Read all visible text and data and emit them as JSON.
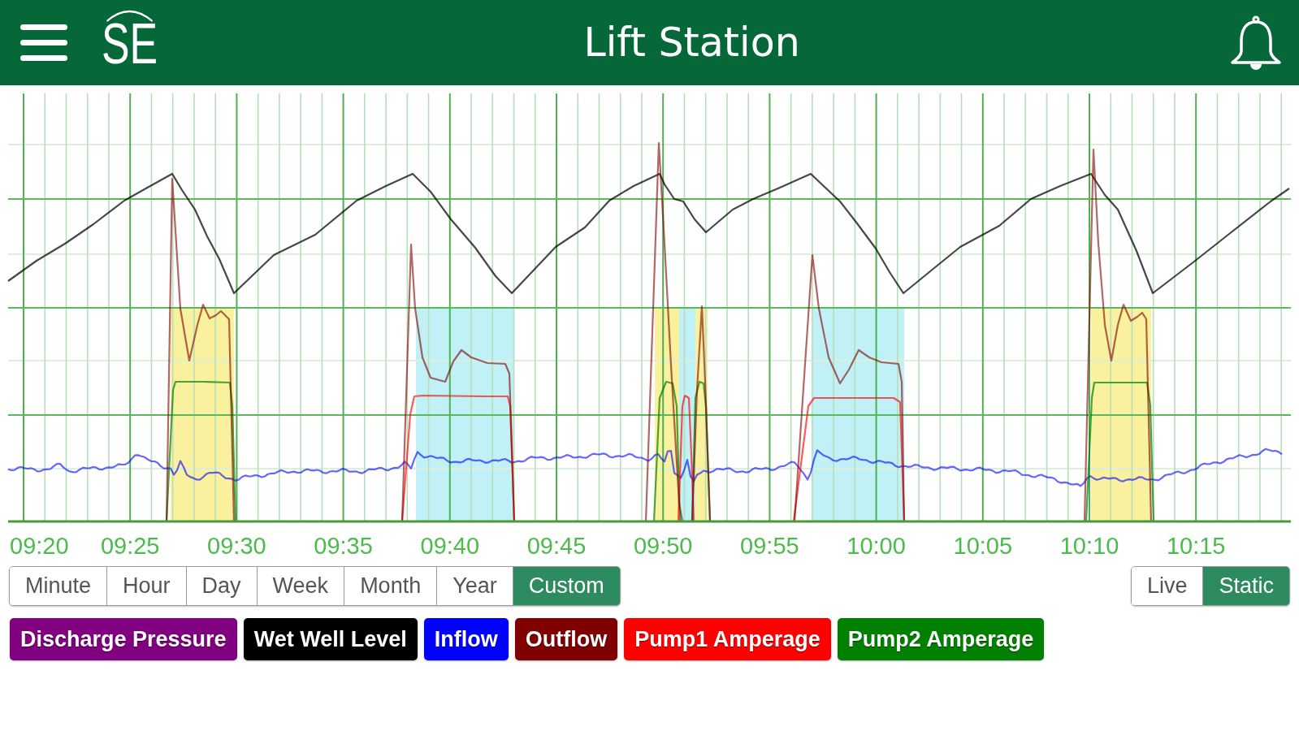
{
  "header": {
    "logo": "SE",
    "title": "Lift Station"
  },
  "chart": {
    "time_labels": [
      "09:20",
      "09:25",
      "09:30",
      "09:35",
      "09:40",
      "09:45",
      "09:50",
      "09:55",
      "10:00",
      "10:05",
      "10:10",
      "10:15"
    ]
  },
  "ranges": [
    {
      "label": "Minute",
      "selected": false
    },
    {
      "label": "Hour",
      "selected": false
    },
    {
      "label": "Day",
      "selected": false
    },
    {
      "label": "Week",
      "selected": false
    },
    {
      "label": "Month",
      "selected": false
    },
    {
      "label": "Year",
      "selected": false
    },
    {
      "label": "Custom",
      "selected": true
    }
  ],
  "modes": [
    {
      "label": "Live",
      "selected": false
    },
    {
      "label": "Static",
      "selected": true
    }
  ],
  "series": [
    {
      "label": "Discharge Pressure",
      "color": "#800080"
    },
    {
      "label": "Wet Well Level",
      "color": "#000000"
    },
    {
      "label": "Inflow",
      "color": "#0000ff"
    },
    {
      "label": "Outflow",
      "color": "#800000"
    },
    {
      "label": "Pump1 Amperage",
      "color": "#ff0000"
    },
    {
      "label": "Pump2 Amperage",
      "color": "#008000"
    }
  ]
}
